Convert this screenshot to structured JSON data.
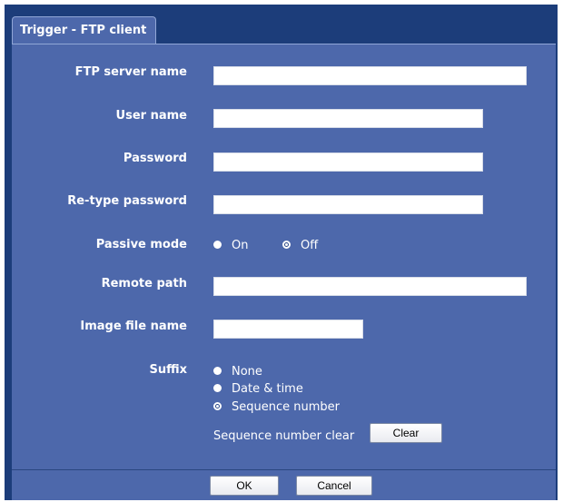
{
  "tab": {
    "title": "Trigger - FTP client"
  },
  "fields": {
    "ftp_server_name": {
      "label": "FTP server name",
      "value": ""
    },
    "user_name": {
      "label": "User name",
      "value": ""
    },
    "password": {
      "label": "Password",
      "value": ""
    },
    "retype_password": {
      "label": "Re-type password",
      "value": ""
    },
    "remote_path": {
      "label": "Remote path",
      "value": ""
    },
    "image_file_name": {
      "label": "Image file name",
      "value": ""
    }
  },
  "passive_mode": {
    "label": "Passive mode",
    "options": [
      "On",
      "Off"
    ],
    "selected": "Off"
  },
  "suffix": {
    "label": "Suffix",
    "options": [
      "None",
      "Date & time",
      "Sequence number"
    ],
    "selected": "Sequence number"
  },
  "sequence_clear": {
    "label": "Sequence number clear",
    "button": "Clear"
  },
  "footer": {
    "ok": "OK",
    "cancel": "Cancel"
  }
}
